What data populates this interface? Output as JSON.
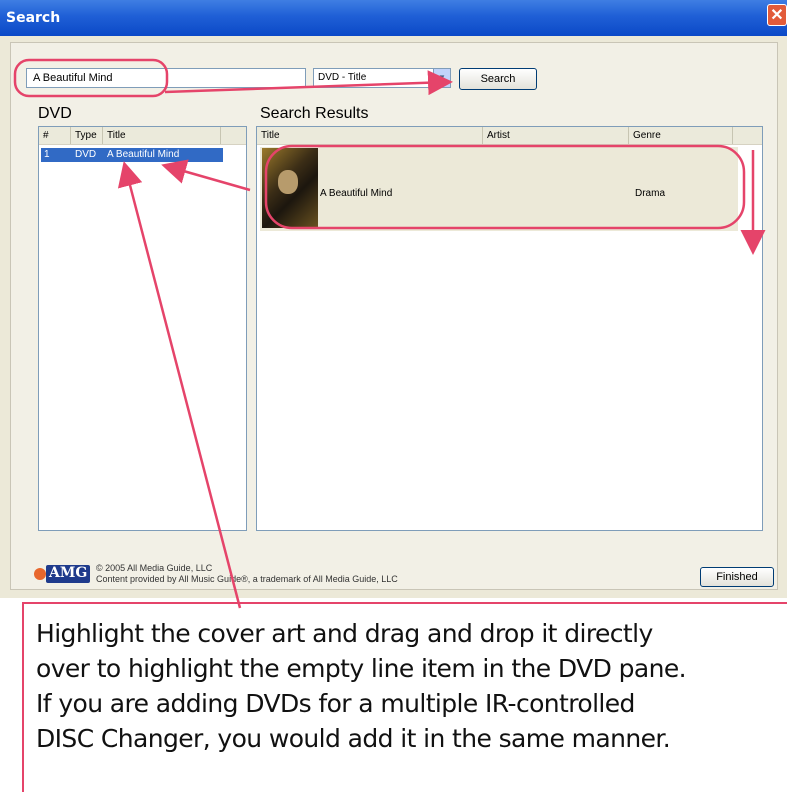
{
  "window": {
    "title": "Search",
    "close_glyph": "✕"
  },
  "search": {
    "query": "A Beautiful Mind",
    "type_selected": "DVD - Title",
    "button_label": "Search"
  },
  "dvd_pane": {
    "label": "DVD",
    "columns": [
      "#",
      "Type",
      "Title"
    ],
    "rows": [
      {
        "num": "1",
        "type": "DVD",
        "title": "A Beautiful Mind"
      }
    ]
  },
  "results_pane": {
    "label": "Search Results",
    "columns": [
      "Title",
      "Artist",
      "Genre"
    ],
    "rows": [
      {
        "title": "A Beautiful Mind",
        "artist": "",
        "genre": "Drama"
      }
    ]
  },
  "footer": {
    "logo_text": "AMG",
    "copyright": "© 2005 All Media Guide, LLC",
    "credit": "Content provided by All Music Guide®, a trademark of All Media Guide, LLC",
    "finished_label": "Finished"
  },
  "caption": {
    "lines": [
      "Highlight the cover art and drag and drop it directly",
      "over to highlight the empty line item in the DVD pane.",
      "If you are adding DVDs for a multiple IR-controlled",
      "DISC Changer, you would add it in the same manner."
    ]
  },
  "colors": {
    "annotation": "#e5446a",
    "selection": "#316ac5",
    "titlebar": "#0b49c7",
    "dialog_bg": "#ece9d8"
  },
  "icons": {
    "close": "close-icon",
    "dropdown": "chevron-down-icon",
    "logo": "amg-logo-icon"
  }
}
